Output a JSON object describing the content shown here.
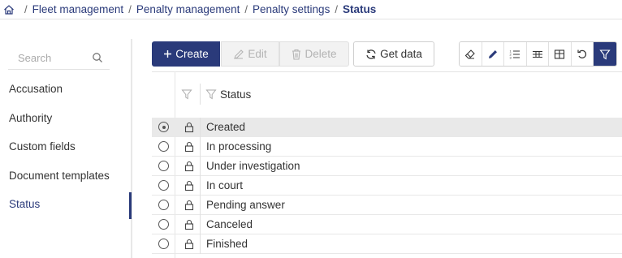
{
  "breadcrumb": {
    "home_icon": "home-icon",
    "items": [
      "Fleet management",
      "Penalty management",
      "Penalty settings",
      "Status"
    ]
  },
  "sidebar": {
    "search_placeholder": "Search",
    "items": [
      {
        "label": "Accusation"
      },
      {
        "label": "Authority"
      },
      {
        "label": "Custom fields"
      },
      {
        "label": "Document templates"
      },
      {
        "label": "Status",
        "active": true
      }
    ]
  },
  "toolbar": {
    "create_label": "Create",
    "edit_label": "Edit",
    "delete_label": "Delete",
    "getdata_label": "Get data",
    "tools": [
      "eraser-icon",
      "pencil-icon",
      "list-icon",
      "rows-icon",
      "table-icon",
      "reset-icon",
      "filter-icon"
    ]
  },
  "table": {
    "column_header": "Status",
    "rows": [
      {
        "label": "Created",
        "selected": true
      },
      {
        "label": "In processing"
      },
      {
        "label": "Under investigation"
      },
      {
        "label": "In court"
      },
      {
        "label": "Pending answer"
      },
      {
        "label": "Canceled"
      },
      {
        "label": "Finished"
      }
    ]
  },
  "colors": {
    "accent": "#2a3a7a",
    "disabled_bg": "#f2f2f2",
    "selected_row": "#e9e9e9"
  }
}
